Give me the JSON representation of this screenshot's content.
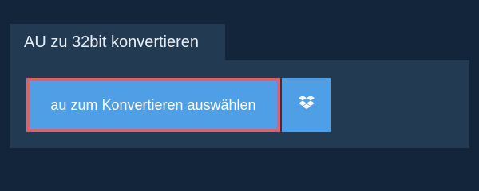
{
  "tab": {
    "title": "AU zu 32bit konvertieren"
  },
  "upload": {
    "choose_label": "au zum Konvertieren auswählen",
    "dropbox_icon": "dropbox-icon"
  },
  "colors": {
    "page_background": "#13253b",
    "panel_background": "#223a52",
    "button_blue": "#4f9fe6",
    "highlight_border": "#e0606a"
  }
}
